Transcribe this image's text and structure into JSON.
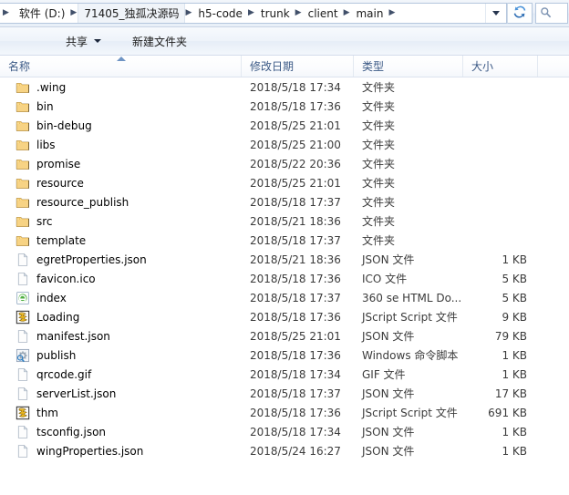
{
  "window": {
    "address": {
      "breadcrumbs": [
        {
          "label": "软件 (D:)",
          "highlight": false
        },
        {
          "label": "71405_独孤决源码",
          "highlight": true
        },
        {
          "label": "h5-code",
          "highlight": false
        },
        {
          "label": "trunk",
          "highlight": false
        },
        {
          "label": "client",
          "highlight": false
        },
        {
          "label": "main",
          "highlight": false
        }
      ],
      "dropdown_icon": "chevron-down-icon",
      "refresh_icon": "refresh-icon",
      "search_placeholder": "搜索"
    },
    "toolbar": {
      "share_label": "共享",
      "new_folder_label": "新建文件夹"
    },
    "columns": {
      "name": "名称",
      "date": "修改日期",
      "type": "类型",
      "size": "大小",
      "sort_column": "名称",
      "sort_direction": "ascending"
    },
    "items": [
      {
        "icon": "folder-icon",
        "name": ".wing",
        "date": "2018/5/18 17:34",
        "type": "文件夹",
        "size": ""
      },
      {
        "icon": "folder-icon",
        "name": "bin",
        "date": "2018/5/18 17:36",
        "type": "文件夹",
        "size": ""
      },
      {
        "icon": "folder-icon",
        "name": "bin-debug",
        "date": "2018/5/25 21:01",
        "type": "文件夹",
        "size": ""
      },
      {
        "icon": "folder-icon",
        "name": "libs",
        "date": "2018/5/25 21:00",
        "type": "文件夹",
        "size": ""
      },
      {
        "icon": "folder-icon",
        "name": "promise",
        "date": "2018/5/22 20:36",
        "type": "文件夹",
        "size": ""
      },
      {
        "icon": "folder-icon",
        "name": "resource",
        "date": "2018/5/25 21:01",
        "type": "文件夹",
        "size": ""
      },
      {
        "icon": "folder-icon",
        "name": "resource_publish",
        "date": "2018/5/18 17:37",
        "type": "文件夹",
        "size": ""
      },
      {
        "icon": "folder-icon",
        "name": "src",
        "date": "2018/5/21 18:36",
        "type": "文件夹",
        "size": ""
      },
      {
        "icon": "folder-icon",
        "name": "template",
        "date": "2018/5/18 17:37",
        "type": "文件夹",
        "size": ""
      },
      {
        "icon": "document-icon",
        "name": "egretProperties.json",
        "date": "2018/5/21 18:36",
        "type": "JSON 文件",
        "size": "1 KB"
      },
      {
        "icon": "document-icon",
        "name": "favicon.ico",
        "date": "2018/5/18 17:36",
        "type": "ICO 文件",
        "size": "5 KB"
      },
      {
        "icon": "browser-icon",
        "name": "index",
        "date": "2018/5/18 17:37",
        "type": "360 se HTML Do...",
        "size": "5 KB"
      },
      {
        "icon": "jscript-icon",
        "name": "Loading",
        "date": "2018/5/18 17:36",
        "type": "JScript Script 文件",
        "size": "9 KB"
      },
      {
        "icon": "document-icon",
        "name": "manifest.json",
        "date": "2018/5/25 21:01",
        "type": "JSON 文件",
        "size": "79 KB"
      },
      {
        "icon": "gear-icon",
        "name": "publish",
        "date": "2018/5/18 17:36",
        "type": "Windows 命令脚本",
        "size": "1 KB"
      },
      {
        "icon": "document-icon",
        "name": "qrcode.gif",
        "date": "2018/5/18 17:34",
        "type": "GIF 文件",
        "size": "1 KB"
      },
      {
        "icon": "document-icon",
        "name": "serverList.json",
        "date": "2018/5/18 17:37",
        "type": "JSON 文件",
        "size": "17 KB"
      },
      {
        "icon": "jscript-icon",
        "name": "thm",
        "date": "2018/5/18 17:36",
        "type": "JScript Script 文件",
        "size": "691 KB"
      },
      {
        "icon": "document-icon",
        "name": "tsconfig.json",
        "date": "2018/5/18 17:34",
        "type": "JSON 文件",
        "size": "1 KB"
      },
      {
        "icon": "document-icon",
        "name": "wingProperties.json",
        "date": "2018/5/24 16:27",
        "type": "JSON 文件",
        "size": "1 KB"
      }
    ],
    "colors": {
      "folder": "#f5cd6c",
      "accent": "#3c5a86",
      "chrome": "#e8eef7"
    }
  }
}
